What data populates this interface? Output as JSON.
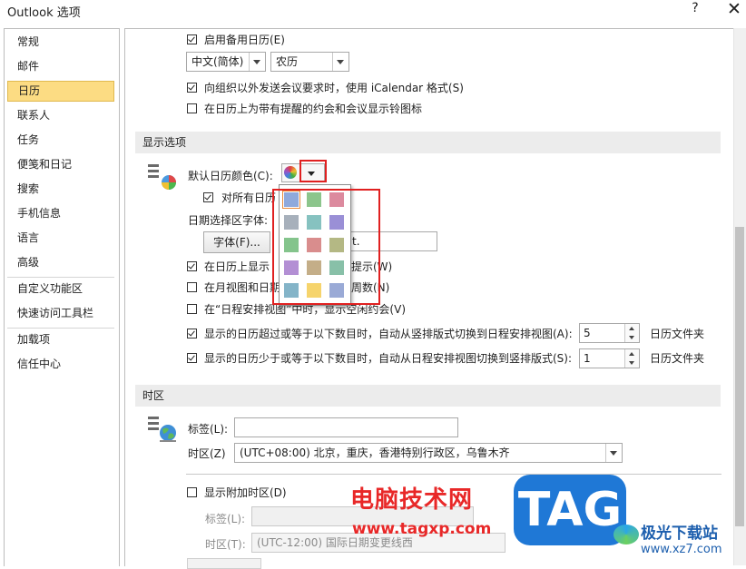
{
  "window": {
    "title": "Outlook 选项",
    "help": "?",
    "close": "✕"
  },
  "nav": {
    "items": [
      {
        "label": "常规"
      },
      {
        "label": "邮件"
      },
      {
        "label": "日历"
      },
      {
        "label": "联系人"
      },
      {
        "label": "任务"
      },
      {
        "label": "便笺和日记"
      },
      {
        "label": "搜索"
      },
      {
        "label": "手机信息"
      },
      {
        "label": "语言"
      },
      {
        "label": "高级"
      },
      {
        "label": "自定义功能区"
      },
      {
        "label": "快速访问工具栏"
      },
      {
        "label": "加载项"
      },
      {
        "label": "信任中心"
      }
    ],
    "selected": "日历"
  },
  "calendar_top": {
    "enable_alt_calendar": {
      "label": "启用备用日历(E)",
      "checked": true
    },
    "language_select": "中文(简体)",
    "calendar_type_select": "农历",
    "icalendar_option": {
      "label": "向组织以外发送会议要求时，使用 iCalendar 格式(S)",
      "checked": true
    },
    "bell_icon_option": {
      "label": "在日历上为带有提醒的约会和会议显示铃图标",
      "checked": false
    }
  },
  "display_options": {
    "header": "显示选项",
    "default_color_label": "默认日历颜色(C):",
    "apply_all": {
      "label": "对所有日历",
      "checked": true
    },
    "date_font_label": "日期选择区字体:",
    "font_button": "字体(F)...",
    "font_preview": "t.",
    "show_on_calendar": {
      "label_left": "在日历上显示",
      "label_right": "提示(W)",
      "checked": true
    },
    "month_view": {
      "label_left": "在月视图和日期",
      "label_right": "周数(N)",
      "checked": false
    },
    "schedule_view": {
      "label": "在“日程安排视图”中时，显示空闲约会(V)",
      "checked": false
    },
    "switch_to_schedule": {
      "label": "显示的日历超过或等于以下数目时，自动从竖排版式切换到日程安排视图(A):",
      "value": "5",
      "unit": "日历文件夹",
      "checked": true
    },
    "switch_to_vertical": {
      "label": "显示的日历少于或等于以下数目时，自动从日程安排视图切换到竖排版式(S):",
      "value": "1",
      "unit": "日历文件夹",
      "checked": true
    }
  },
  "color_palette": {
    "rows": [
      [
        "#8fa9dc",
        "#8cc58c",
        "#dc8a9e"
      ],
      [
        "#a7b0bb",
        "#86c2c0",
        "#9a8fd6"
      ],
      [
        "#84c48c",
        "#d98d8d",
        "#b4b884"
      ],
      [
        "#b38fd4",
        "#c4ae88",
        "#88c0a8"
      ],
      [
        "#84b4c8",
        "#f6d46c",
        "#9aaad6"
      ]
    ],
    "selected": "#8fa9dc"
  },
  "timezone": {
    "header": "时区",
    "label_label": "标签(L):",
    "label_value": "",
    "zone_label": "时区(Z)",
    "zone_value": "(UTC+08:00) 北京，重庆，香港特别行政区，乌鲁木齐",
    "show_additional": {
      "label": "显示附加时区(D)",
      "checked": false
    },
    "add_label_label": "标签(L):",
    "add_zone_label": "时区(T):",
    "add_zone_value": "(UTC-12:00) 国际日期变更线西"
  },
  "watermark": {
    "text_cn": "电脑技术网",
    "url": "www.tagxp.com",
    "tag": "TAG",
    "site_name": "极光下载站",
    "site_url": "www.xz7.com"
  },
  "colors": {
    "nav_selected_bg": "#fcdc83",
    "section_header_bg": "#ececec",
    "highlight_red": "#e02020",
    "watermark_blue": "#1f78d6"
  }
}
